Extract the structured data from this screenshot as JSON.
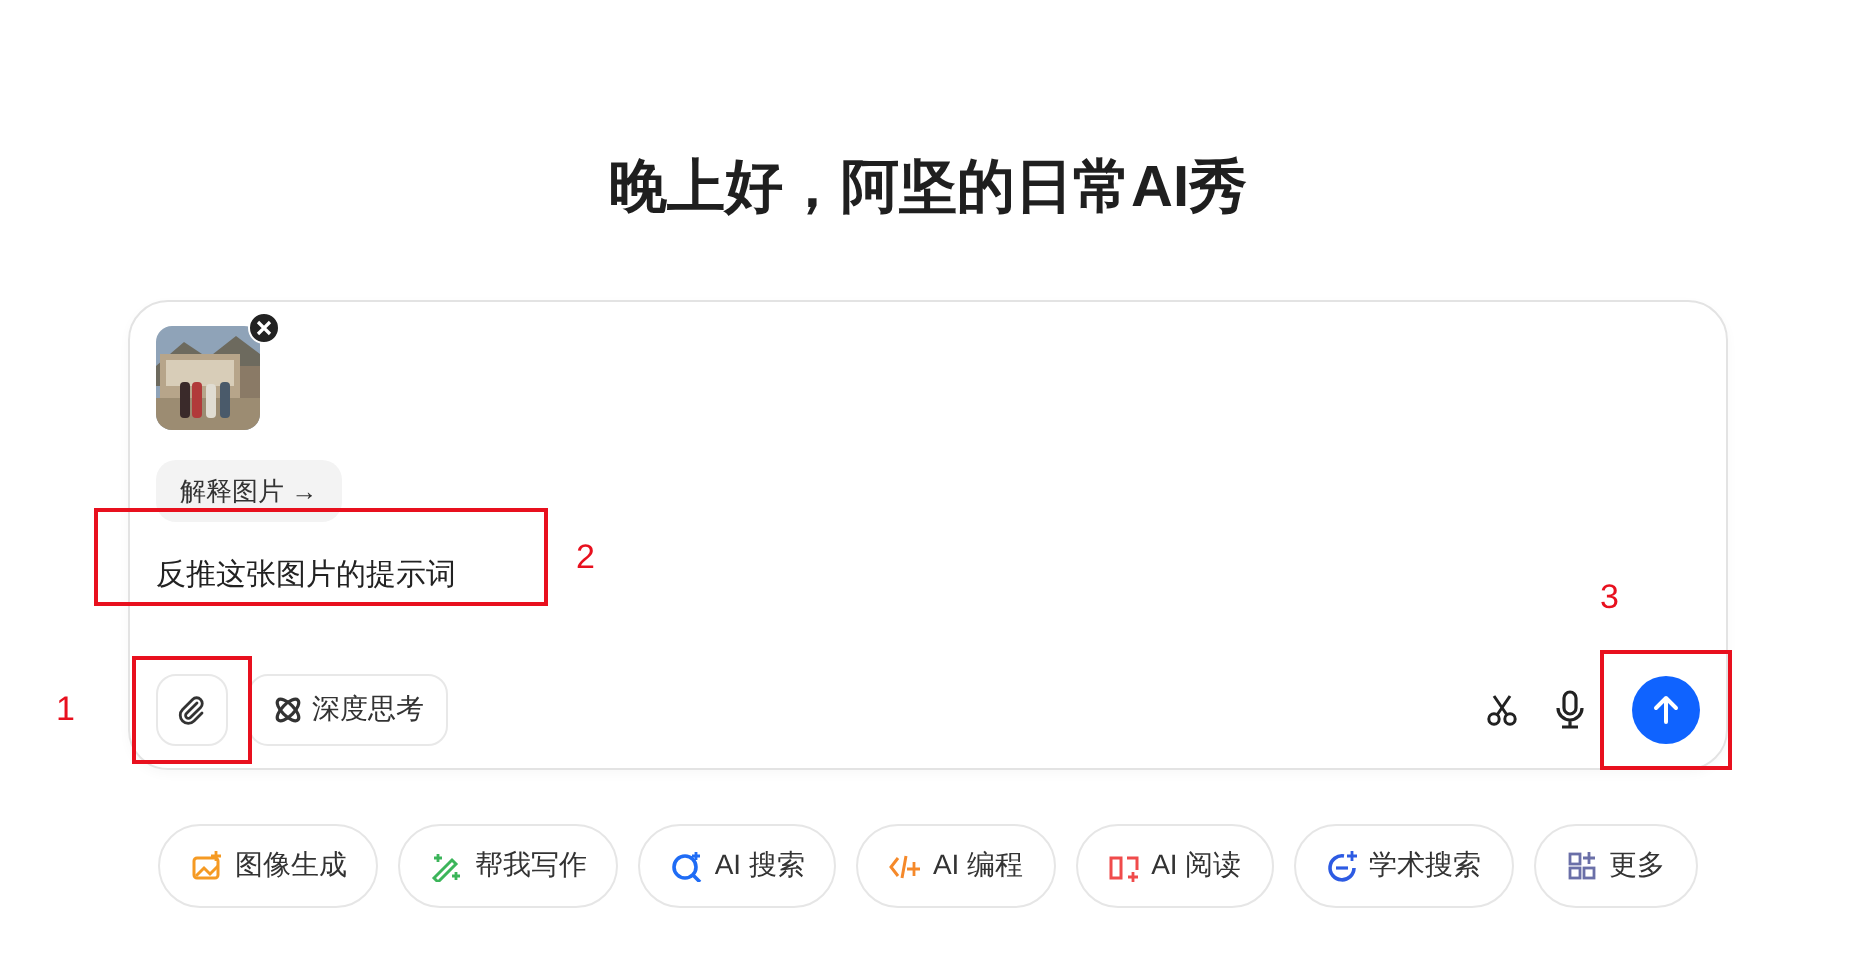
{
  "greeting": "晚上好，阿坚的日常AI秀",
  "composer": {
    "suggestion": "解释图片 →",
    "prompt": "反推这张图片的提示词",
    "deep_think": {
      "label": "深度思考",
      "on": false
    }
  },
  "shortcuts": [
    {
      "label": "图像生成",
      "color": "#f59a23"
    },
    {
      "label": "帮我写作",
      "color": "#3cb55a"
    },
    {
      "label": "AI 搜索",
      "color": "#1f6cf5"
    },
    {
      "label": "AI 编程",
      "color": "#f5892a"
    },
    {
      "label": "AI 阅读",
      "color": "#f04b4b"
    },
    {
      "label": "学术搜索",
      "color": "#2d5be3"
    },
    {
      "label": "更多",
      "color": "#6a6fa8"
    }
  ],
  "annotations": [
    {
      "label": "1",
      "kind": "attach"
    },
    {
      "label": "2",
      "kind": "prompt"
    },
    {
      "label": "3",
      "kind": "send"
    }
  ]
}
